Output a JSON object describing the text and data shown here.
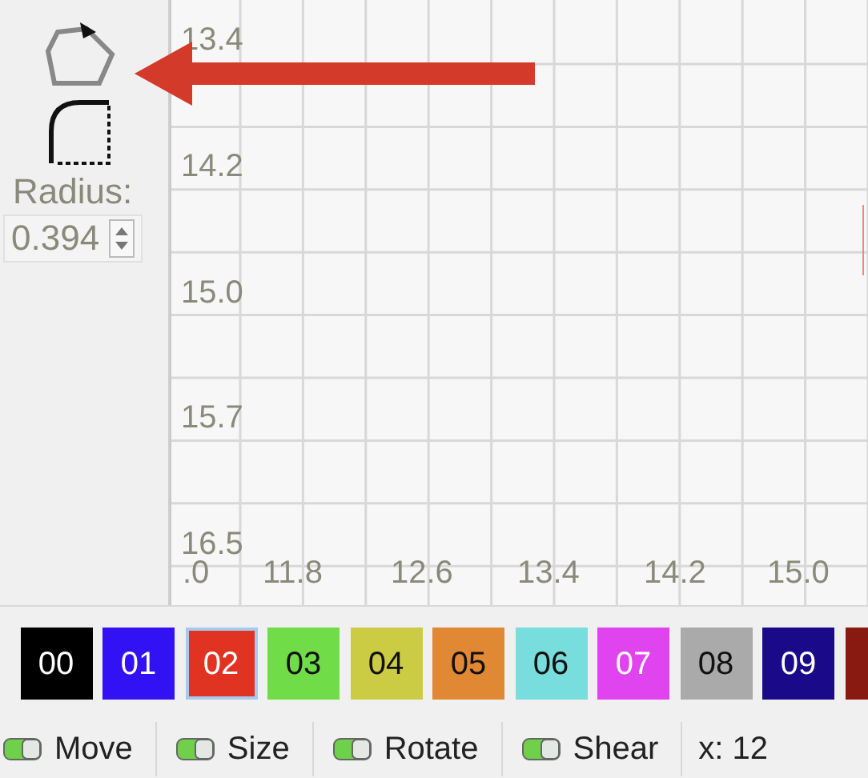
{
  "tool_panel": {
    "radius_label": "Radius:",
    "radius_value": "0.394"
  },
  "canvas": {
    "y_labels": [
      "13.4",
      "14.2",
      "15.0",
      "15.7",
      "16.5"
    ],
    "x_labels": [
      ".0",
      "11.8",
      "12.6",
      "13.4",
      "14.2",
      "15.0"
    ]
  },
  "palette": [
    {
      "label": "00",
      "color": "#000000",
      "selected": false
    },
    {
      "label": "01",
      "color": "#3311f5",
      "selected": false
    },
    {
      "label": "02",
      "color": "#e03322",
      "selected": true
    },
    {
      "label": "03",
      "color": "#70dc48",
      "selected": false
    },
    {
      "label": "04",
      "color": "#cccc44",
      "selected": false
    },
    {
      "label": "05",
      "color": "#e08833",
      "selected": false
    },
    {
      "label": "06",
      "color": "#77dddd",
      "selected": false
    },
    {
      "label": "07",
      "color": "#e044ee",
      "selected": false
    },
    {
      "label": "08",
      "color": "#aaaaaa",
      "selected": false
    },
    {
      "label": "09",
      "color": "#1a0a8a",
      "selected": false
    },
    {
      "color": "#881a11",
      "selected": false
    }
  ],
  "status_bar": {
    "toggles": [
      {
        "label": "Move",
        "on": true
      },
      {
        "label": "Size",
        "on": true
      },
      {
        "label": "Rotate",
        "on": true
      },
      {
        "label": "Shear",
        "on": true
      }
    ],
    "coordinates": "x: 12"
  }
}
